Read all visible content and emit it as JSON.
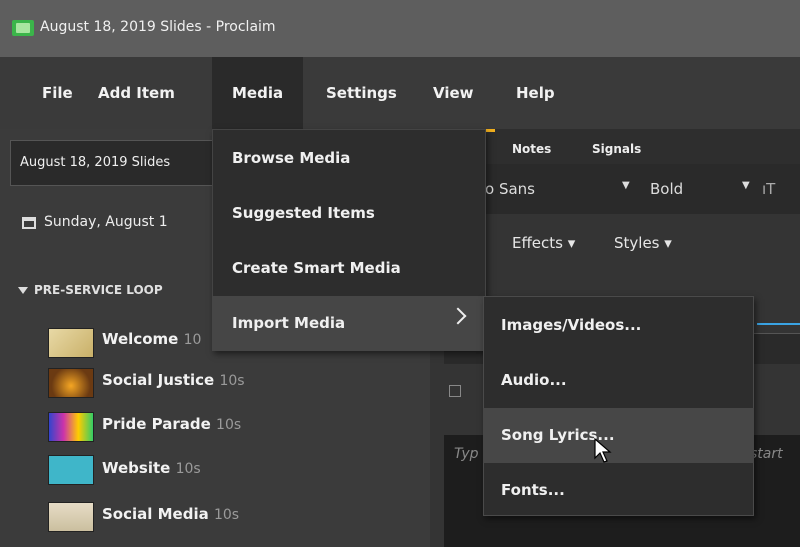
{
  "window": {
    "title": "August 18, 2019 Slides - Proclaim"
  },
  "menubar": [
    "File",
    "Add Item",
    "Media",
    "Settings",
    "View",
    "Help"
  ],
  "sidebar": {
    "doc_select": "August 18, 2019 Slides",
    "date": "Sunday, August 1",
    "section": "PRE-SERVICE LOOP",
    "items": [
      {
        "name": "Welcome",
        "duration": "10"
      },
      {
        "name": "Social Justice",
        "duration": "10s"
      },
      {
        "name": "Pride Parade",
        "duration": "10s"
      },
      {
        "name": "Website",
        "duration": "10s"
      },
      {
        "name": "Social Media",
        "duration": "10s"
      }
    ]
  },
  "editor": {
    "tabs": [
      "Notes",
      "Signals"
    ],
    "font_name": "o Sans",
    "font_weight": "Bold",
    "font_size_icon": "ıT",
    "effects": "Effects ▾",
    "styles": "Styles ▾",
    "type_hint": "Typ",
    "start_hint": "start"
  },
  "media_menu": {
    "items": [
      "Browse Media",
      "Suggested Items",
      "Create Smart Media",
      "Import Media"
    ],
    "highlighted": "Import Media"
  },
  "import_submenu": {
    "items": [
      "Images/Videos...",
      "Audio...",
      "Song Lyrics...",
      "Fonts..."
    ],
    "highlighted": "Song Lyrics..."
  },
  "colors": {
    "accent_green": "#3bb54a",
    "tab_accent": "#f2b01e",
    "blue_line": "#3aa3e3"
  },
  "icons": [
    "app-icon",
    "calendar-icon",
    "triangle-down-icon",
    "chevron-right-icon",
    "dropdown-arrow-icon",
    "mouse-pointer-icon"
  ]
}
